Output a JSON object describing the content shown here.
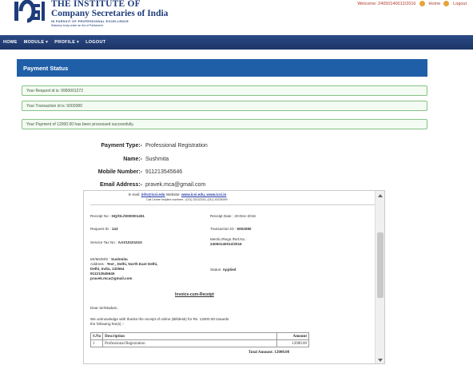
{
  "header": {
    "org_line1": "THE INSTITUTE OF",
    "org_line2": "Company Secretaries of India",
    "tagline": "IN PURSUIT OF PROFESSIONAL EXCELLENCE",
    "subtagline": "Statutory body under an Act of Parliament",
    "welcome": "Welcome: 24050140012/2016",
    "home_label": "Home",
    "logout_label": "Logout"
  },
  "nav": {
    "home": "HOME",
    "module": "MODULE ▾",
    "profile": "PROFILE ▾",
    "logout": "LOGOUT"
  },
  "panel": {
    "title": "Payment Status",
    "messages": [
      "Your Request id is: 9950001272",
      "Your Transaction id is: 5002080",
      "Your Payment of  12000.00  has been processed successfully."
    ]
  },
  "details": [
    {
      "label": "Payment Type:-",
      "value": "Professional Registration"
    },
    {
      "label": "Name:-",
      "value": "Sushmita"
    },
    {
      "label": "Mobile Number:-",
      "value": "911213545646"
    },
    {
      "label": "Email Address:-",
      "value": "pravek.mca@gmail.com"
    }
  ],
  "receipt": {
    "email_prefix": "E-mail:",
    "email": "info@icsi.edu",
    "website_prefix": "Website:",
    "website": "www.icsi.edu, www.icsi.in",
    "helpline": "Call Centre helpline numbers : (011) 33132333, (011) 40234999",
    "receipt_no_label": "Receipt No :",
    "receipt_no": "HQ/OL/0000001451",
    "receipt_date_label": "Receipt Date :",
    "receipt_date": "20-Dec-2016",
    "request_id_label": "Request ID :",
    "request_id": "143",
    "transaction_id_label": "Transaction ID :",
    "transaction_id": "5002080",
    "service_tax_label": "Service Tax No :",
    "service_tax": "AAX10101010",
    "memb_label": "Memb./Regn./Ref.No :",
    "memb_no": "24050140012/2016",
    "name_label": "Mr/Ms/M/S :",
    "name": "Sushmita",
    "address_label": "Address :",
    "address1": "Test , Delhi, North East Delhi,",
    "address2": "Delhi, India, 132564",
    "phone": "911213545646",
    "email2": "pravek.mca@gmail.com",
    "status_label": "Status:",
    "status": "Applied",
    "doc_title": "Invoice-cum-Receipt",
    "salutation": "Dear Sir/Madam,",
    "ack1": "We acknowledge with thanks the receipt of online (Billdesk) for Rs. 12000.00 towards",
    "ack2": "the following fee(s) :-",
    "table_headers": [
      "S.No",
      "Description",
      "Amount"
    ],
    "table_rows": [
      {
        "sno": "1",
        "desc": "Professional Registration",
        "amount": "12000.00"
      }
    ],
    "total": "Total Amount: 12000.00"
  }
}
